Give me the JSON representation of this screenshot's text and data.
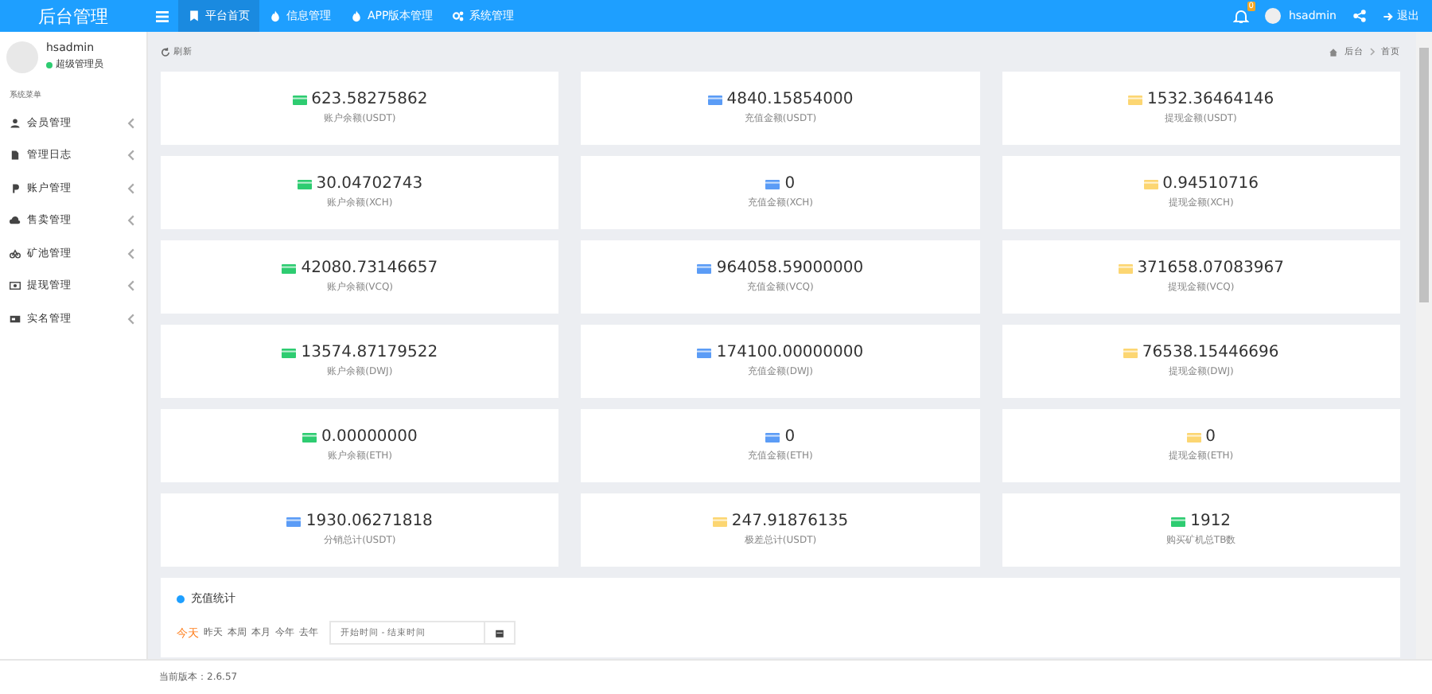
{
  "logo": "后台管理",
  "nav": [
    {
      "label": "平台首页",
      "selected": true
    },
    {
      "label": "信息管理",
      "selected": false
    },
    {
      "label": "APP版本管理",
      "selected": false
    },
    {
      "label": "系统管理",
      "selected": false
    }
  ],
  "header_right": {
    "notification_count": "0",
    "user": "hsadmin",
    "logout": "退出"
  },
  "user": {
    "name": "hsadmin",
    "role": "超级管理员",
    "online": true
  },
  "sidebar": {
    "title": "系统菜单",
    "items": [
      {
        "label": "会员管理"
      },
      {
        "label": "管理日志"
      },
      {
        "label": "账户管理"
      },
      {
        "label": "售卖管理"
      },
      {
        "label": "矿池管理"
      },
      {
        "label": "提现管理"
      },
      {
        "label": "实名管理"
      }
    ]
  },
  "toolbar": {
    "refresh": "刷新",
    "breadcrumb": [
      "后台",
      "首页"
    ]
  },
  "stats": [
    {
      "value": "623.58275862",
      "label": "账户余额(USDT)",
      "color": "#2ecc71"
    },
    {
      "value": "4840.15854000",
      "label": "充值金额(USDT)",
      "color": "#5b9cf6"
    },
    {
      "value": "1532.36464146",
      "label": "提现金额(USDT)",
      "color": "#fcd672"
    },
    {
      "value": "30.04702743",
      "label": "账户余额(XCH)",
      "color": "#2ecc71"
    },
    {
      "value": "0",
      "label": "充值金额(XCH)",
      "color": "#5b9cf6"
    },
    {
      "value": "0.94510716",
      "label": "提现金额(XCH)",
      "color": "#fcd672"
    },
    {
      "value": "42080.73146657",
      "label": "账户余额(VCQ)",
      "color": "#2ecc71"
    },
    {
      "value": "964058.59000000",
      "label": "充值金额(VCQ)",
      "color": "#5b9cf6"
    },
    {
      "value": "371658.07083967",
      "label": "提现金额(VCQ)",
      "color": "#fcd672"
    },
    {
      "value": "13574.87179522",
      "label": "账户余额(DWJ)",
      "color": "#2ecc71"
    },
    {
      "value": "174100.00000000",
      "label": "充值金额(DWJ)",
      "color": "#5b9cf6"
    },
    {
      "value": "76538.15446696",
      "label": "提现金额(DWJ)",
      "color": "#fcd672"
    },
    {
      "value": "0.00000000",
      "label": "账户余额(ETH)",
      "color": "#2ecc71"
    },
    {
      "value": "0",
      "label": "充值金额(ETH)",
      "color": "#5b9cf6"
    },
    {
      "value": "0",
      "label": "提现金额(ETH)",
      "color": "#fcd672"
    },
    {
      "value": "1930.06271818",
      "label": "分销总计(USDT)",
      "color": "#5b9cf6"
    },
    {
      "value": "247.91876135",
      "label": "极差总计(USDT)",
      "color": "#fcd672"
    },
    {
      "value": "1912",
      "label": "购买矿机总TB数",
      "color": "#2ecc71"
    }
  ],
  "recharge_panel": {
    "title": "充值统计",
    "periods": [
      {
        "label": "今天",
        "selected": true
      },
      {
        "label": "昨天",
        "selected": false
      },
      {
        "label": "本周",
        "selected": false
      },
      {
        "label": "本月",
        "selected": false
      },
      {
        "label": "今年",
        "selected": false
      },
      {
        "label": "去年",
        "selected": false
      }
    ],
    "date_range": {
      "placeholder": "开始时间 - 结束时间"
    }
  },
  "footer": {
    "version": "当前版本：2.6.57"
  }
}
